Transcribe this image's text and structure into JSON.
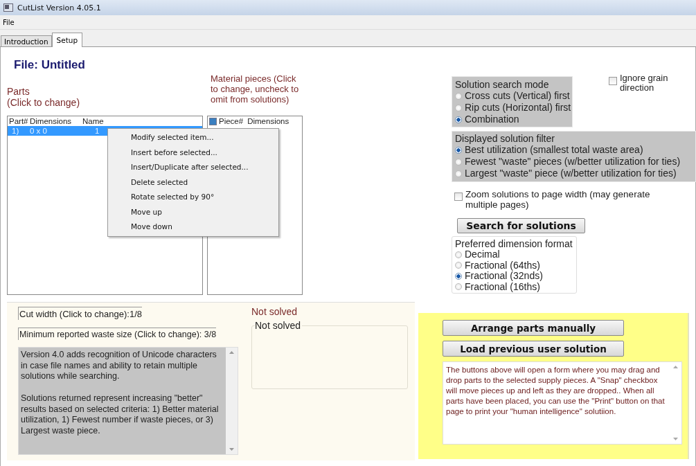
{
  "window": {
    "title": "CutList Version 4.05.1"
  },
  "menu_bar": [
    "File"
  ],
  "tabs": [
    {
      "label": "Introduction",
      "selected": false
    },
    {
      "label": "Setup",
      "selected": true
    }
  ],
  "file_title": "File: Untitled",
  "parts": {
    "label": [
      "Parts",
      "(Click to change)"
    ],
    "columns": [
      "Part#",
      "Dimensions",
      "Name"
    ],
    "rows": [
      {
        "cells": [
          "1)",
          "0 x 0",
          "1"
        ],
        "selected": true
      }
    ]
  },
  "context_menu": [
    "Modify selected item...",
    "Insert before selected...",
    "Insert/Duplicate after selected...",
    "Delete selected",
    "Rotate selected by 90°",
    "Move up",
    "Move down"
  ],
  "material_pieces": {
    "label": [
      "Material pieces  (Click",
      "to change,  uncheck to",
      "omit from solutions)"
    ],
    "header_checked": true,
    "columns": [
      "Piece#",
      "Dimensions"
    ]
  },
  "search_mode": {
    "title": "Solution search mode",
    "options": [
      {
        "label": "Cross cuts (Vertical) first",
        "selected": false
      },
      {
        "label": "Rip cuts (Horizontal) first",
        "selected": false
      },
      {
        "label": "Combination",
        "selected": true
      }
    ]
  },
  "ignore_grain": {
    "label": [
      "Ignore grain",
      "direction"
    ],
    "checked": false
  },
  "solution_filter": {
    "title": "Displayed solution filter",
    "options": [
      {
        "label": "Best utilization (smallest total waste area)",
        "selected": true
      },
      {
        "label": "Fewest \"waste\" pieces  (w/better utilization for ties)",
        "selected": false
      },
      {
        "label": "Largest \"waste\" piece (w/better utilization for ties)",
        "selected": false
      }
    ]
  },
  "zoom_option": {
    "label": [
      "Zoom solutions to page width (may generate",
      "multiple pages)"
    ],
    "checked": false
  },
  "search_button": "Search for solutions",
  "dimension_format": {
    "title": "Preferred dimension format",
    "options": [
      {
        "label": "Decimal",
        "selected": false
      },
      {
        "label": "Fractional  (64ths)",
        "selected": false
      },
      {
        "label": "Fractional (32nds)",
        "selected": true
      },
      {
        "label": "Fractional (16ths)",
        "selected": false
      }
    ]
  },
  "cut_width": "Cut width (Click to change):1/8",
  "min_waste": "Minimum reported waste size (Click to change): 3/8",
  "info_text": [
    "Version 4.0 adds recognition of Unicode characters in case file names and ability to  retain multiple solutions while searching.",
    "Solutions returned represent increasing \"better\" results based on selected criteria: 1) Better material  utilization, 1) Fewest number if  waste pieces, or 3) Largest waste piece."
  ],
  "not_solved_label": "Not solved",
  "not_solved_group": "Not solved",
  "arrange_button": "Arrange parts manually",
  "load_button": "Load previous user solution",
  "help_text": "The buttons above will open a form where you may drag  and drop parts to the selected supply pieces.   A \"Snap\"  checkbox will move pieces up and left as  they are dropped..   When all parts  have been placed, you can use the  \"Print\" button on that page to print your \"human intelligence\" solutiion."
}
